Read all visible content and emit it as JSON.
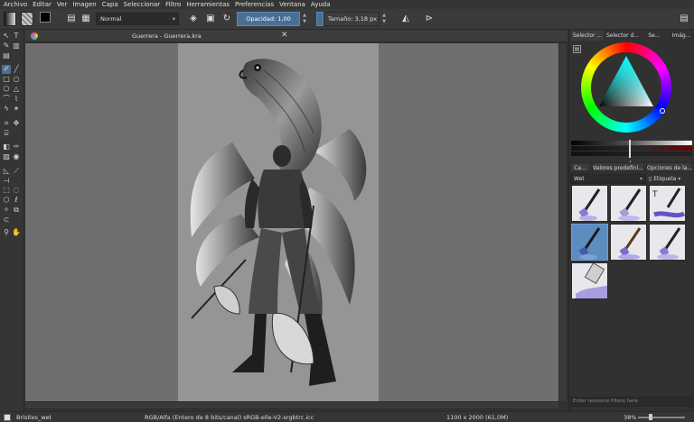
{
  "menu": [
    "Archivo",
    "Editar",
    "Ver",
    "Imagen",
    "Capa",
    "Seleccionar",
    "Filtro",
    "Herramientas",
    "Preferencias",
    "Ventana",
    "Ayuda"
  ],
  "toolbar": {
    "blend_mode": "Normal",
    "opacity_label": "Opacidad: 1,00",
    "size_label": "Tamaño:",
    "size_value": "3,18 px"
  },
  "document": {
    "title": "Guerrera - Guerrera.kra"
  },
  "docker": {
    "top_tabs": [
      "Selector ...",
      "Selector d...",
      "Se...",
      "Imág..."
    ],
    "preset_tabs": [
      "Ca...",
      "Valores predefini...",
      "Opciones de la..."
    ],
    "brush_filter": "Wet",
    "tag_label": "Etiqueta",
    "filter_placeholder": "Enter resource filters here"
  },
  "status": {
    "brush": "Bristles_wet",
    "color_info": "RGB/Alfa (Entero de 8 bits/canal)  sRGB-elle-V2-srgbtrc.icc",
    "dimensions": "1100 x 2000 (61,0M)",
    "zoom": "38%"
  },
  "colors": {
    "accent": "#4a6f96",
    "canvas_bg": "#6f6f6f",
    "image_bg": "#959595",
    "panel": "#313131"
  }
}
